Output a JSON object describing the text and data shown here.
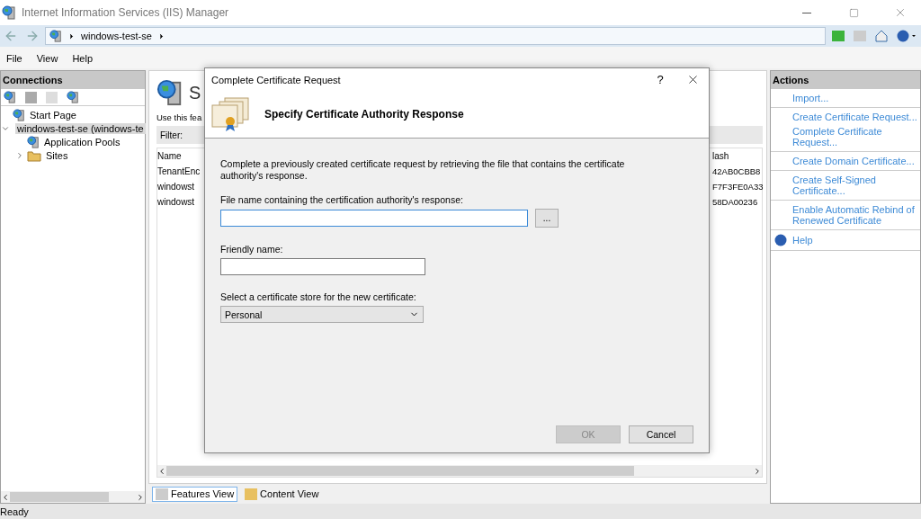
{
  "window": {
    "title": "Internet Information Services (IIS) Manager"
  },
  "address": {
    "crumbs": [
      "windows-test-se"
    ]
  },
  "menu": [
    "File",
    "View",
    "Help"
  ],
  "connections": {
    "title": "Connections",
    "tree": [
      {
        "label": "Start Page",
        "selected": false
      },
      {
        "label": "windows-test-se (windows-te",
        "selected": true,
        "expanded": true,
        "children": [
          {
            "label": "Application Pools",
            "selected": false
          },
          {
            "label": "Sites",
            "selected": false,
            "expanded": false
          }
        ]
      }
    ]
  },
  "center": {
    "heading": "S",
    "description": "Use this fea",
    "filter_label": "Filter:",
    "columns": [
      "Name",
      "lash"
    ],
    "rows": [
      [
        "TenantEnc",
        "42AB0CBB8"
      ],
      [
        "windowst",
        "F7F3FE0A33"
      ],
      [
        "windowst",
        "58DA00236"
      ]
    ]
  },
  "view_tabs": [
    {
      "label": "Features View",
      "selected": true
    },
    {
      "label": "Content View",
      "selected": false
    }
  ],
  "actions": {
    "title": "Actions",
    "groups": [
      [
        {
          "kind": "link",
          "label": "Import..."
        }
      ],
      [
        {
          "kind": "link",
          "label": "Create Certificate Request..."
        },
        {
          "kind": "link",
          "label": "Complete Certificate Request..."
        }
      ],
      [
        {
          "kind": "link",
          "label": "Create Domain Certificate..."
        }
      ],
      [
        {
          "kind": "link",
          "label": "Create Self-Signed Certificate..."
        }
      ],
      [
        {
          "kind": "link",
          "label": "Enable Automatic Rebind of Renewed Certificate"
        }
      ],
      [
        {
          "kind": "help",
          "label": "Help"
        }
      ]
    ]
  },
  "status_bar": "Ready",
  "dialog": {
    "title": "Complete Certificate Request",
    "help_button": "?",
    "heading": "Specify Certificate Authority Response",
    "description": "Complete a previously created certificate request by retrieving the file that contains the certificate authority's response.",
    "fields": [
      {
        "kind": "file",
        "label": "File name containing the certification authority's response:",
        "browse": "...",
        "focused": true
      },
      {
        "kind": "text",
        "label": "Friendly name:"
      },
      {
        "kind": "select",
        "label": "Select a certificate store for the new certificate:",
        "value": "Personal"
      }
    ],
    "buttons": [
      {
        "label": "OK",
        "disabled": true
      },
      {
        "label": "Cancel",
        "disabled": false
      }
    ]
  }
}
